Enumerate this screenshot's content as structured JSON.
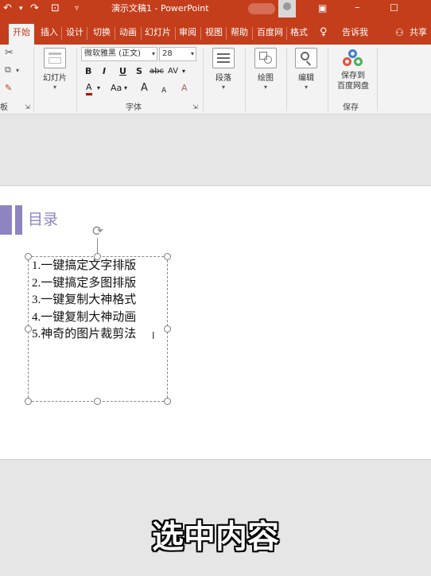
{
  "titlebar": {
    "title": "演示文稿1  -  PowerPoint",
    "undo": "↶",
    "redo": "↷",
    "customize": "▿"
  },
  "tabs": [
    "开始",
    "插入",
    "设计",
    "切换",
    "动画",
    "幻灯片",
    "审阅",
    "视图",
    "帮助",
    "百度网",
    "格式",
    "告诉我",
    "共享"
  ],
  "ribbon": {
    "clipboard_label": "板",
    "slides_button": "幻灯片",
    "font_name": "微软雅黑 (正文)",
    "font_size": "28",
    "bold": "B",
    "italic": "I",
    "underline": "U",
    "shadow": "S",
    "strike": "abc",
    "spacing": "AV",
    "font_color": "A",
    "change_case": "Aa",
    "grow": "A",
    "shrink": "A",
    "clear": "A",
    "font_group_label": "字体",
    "paragraph_button": "段落",
    "draw_button": "绘图",
    "edit_button": "编辑",
    "save_button_line1": "保存到",
    "save_button_line2": "百度网盘",
    "save_group_label": "保存"
  },
  "slide": {
    "heading": "目录",
    "items": [
      "1.一键搞定文字排版",
      "2.一键搞定多图排版",
      "3.一键复制大神格式",
      "4.一键复制大神动画",
      "5.神奇的图片裁剪法"
    ]
  },
  "caption": "选中内容",
  "colors": {
    "accent": "#c43e1c",
    "title_purple": "#8f84c2"
  }
}
